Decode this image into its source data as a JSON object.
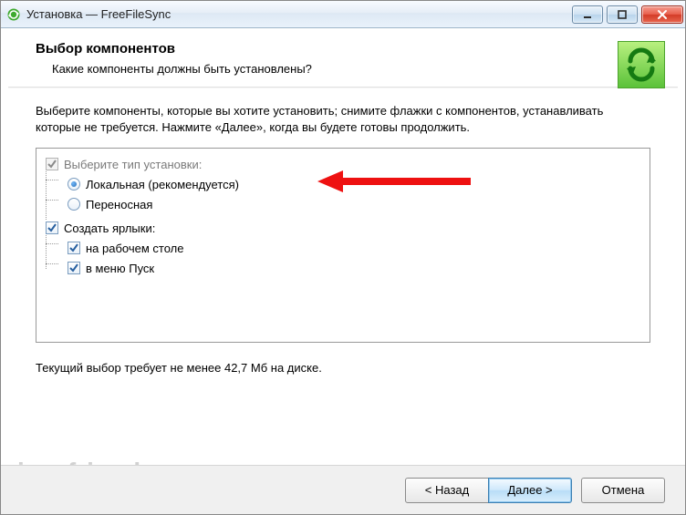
{
  "window": {
    "title": "Установка — FreeFileSync"
  },
  "header": {
    "heading": "Выбор компонентов",
    "subtext": "Какие компоненты должны быть установлены?"
  },
  "body": {
    "instructions": "Выберите компоненты, которые вы хотите установить; снимите флажки с компонентов, устанавливать которые не требуется. Нажмите «Далее», когда вы будете готовы продолжить.",
    "install_type_label": "Выберите тип установки:",
    "options": {
      "local": "Локальная (рекомендуется)",
      "portable": "Переносная"
    },
    "shortcuts_label": "Создать ярлыки:",
    "shortcuts": {
      "desktop": "на рабочем столе",
      "startmenu": "в меню Пуск"
    },
    "disk_requirement": "Текущий выбор требует не менее 42,7 Мб на диске."
  },
  "footer": {
    "back": "< Назад",
    "next": "Далее >",
    "cancel": "Отмена"
  },
  "watermark": "ironfriends.ru",
  "state": {
    "install_type_checked": true,
    "install_type_disabled": true,
    "selected_install": "local",
    "shortcuts_checked": true,
    "desktop_checked": true,
    "startmenu_checked": true
  }
}
